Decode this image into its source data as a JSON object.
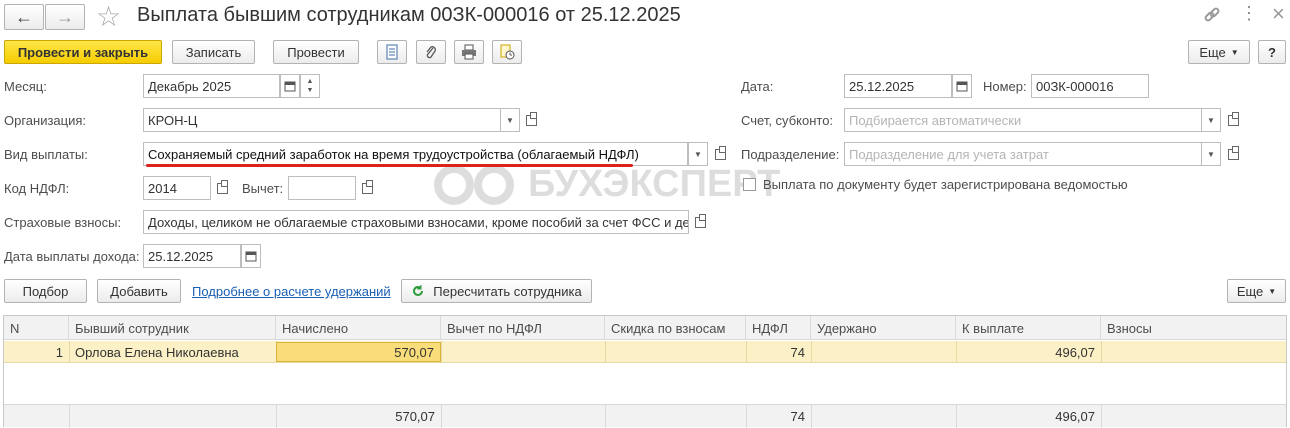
{
  "window": {
    "title": "Выплата бывшим сотрудникам 00ЗК-000016 от 25.12.2025",
    "nav_back": "←",
    "nav_forward": "→",
    "star": "☆",
    "link_icon": "🔗",
    "more_icon": "⋮",
    "close_icon": "×"
  },
  "toolbar": {
    "post_and_close": "Провести и закрыть",
    "save": "Записать",
    "post": "Провести",
    "more": "Еще",
    "help": "?"
  },
  "form": {
    "month_label": "Месяц:",
    "month_value": "Декабрь 2025",
    "org_label": "Организация:",
    "org_value": "КРОН-Ц",
    "paytype_label": "Вид выплаты:",
    "paytype_value": "Сохраняемый средний заработок на время трудоустройства (облагаемый НДФЛ)",
    "ndfl_code_label": "Код НДФЛ:",
    "ndfl_code_value": "2014",
    "deduction_label": "Вычет:",
    "deduction_value": "",
    "insurance_label": "Страховые взносы:",
    "insurance_value": "Доходы, целиком не облагаемые страховыми взносами, кроме пособий за счет ФСС и де",
    "income_date_label": "Дата выплаты дохода:",
    "income_date_value": "25.12.2025",
    "date_label": "Дата:",
    "date_value": "25.12.2025",
    "number_label": "Номер:",
    "number_value": "00ЗК-000016",
    "account_label": "Счет, субконто:",
    "account_placeholder": "Подбирается автоматически",
    "department_label": "Подразделение:",
    "department_placeholder": "Подразделение для учета затрат",
    "statement_checkbox_label": "Выплата по документу будет зарегистрирована ведомостью",
    "statement_checked": false
  },
  "watermark": "БУХЭКСПЕРТ",
  "table_toolbar": {
    "pick": "Подбор",
    "add": "Добавить",
    "details_link": "Подробнее о расчете удержаний",
    "recalc": "Пересчитать сотрудника",
    "more": "Еще"
  },
  "table": {
    "columns": [
      "N",
      "Бывший сотрудник",
      "Начислено",
      "Вычет по НДФЛ",
      "Скидка по взносам",
      "НДФЛ",
      "Удержано",
      "К выплате",
      "Взносы"
    ],
    "rows": [
      {
        "n": "1",
        "employee": "Орлова Елена Николаевна",
        "accrued": "570,07",
        "deduction": "",
        "discount": "",
        "ndfl": "74",
        "withheld": "",
        "to_pay": "496,07",
        "contrib": ""
      }
    ],
    "totals": {
      "accrued": "570,07",
      "ndfl": "74",
      "to_pay": "496,07"
    }
  },
  "colors": {
    "primary": "#f6cc00",
    "selected_row": "#fbf0c6",
    "underline": "#d9231b",
    "link": "#1a5fb4"
  }
}
